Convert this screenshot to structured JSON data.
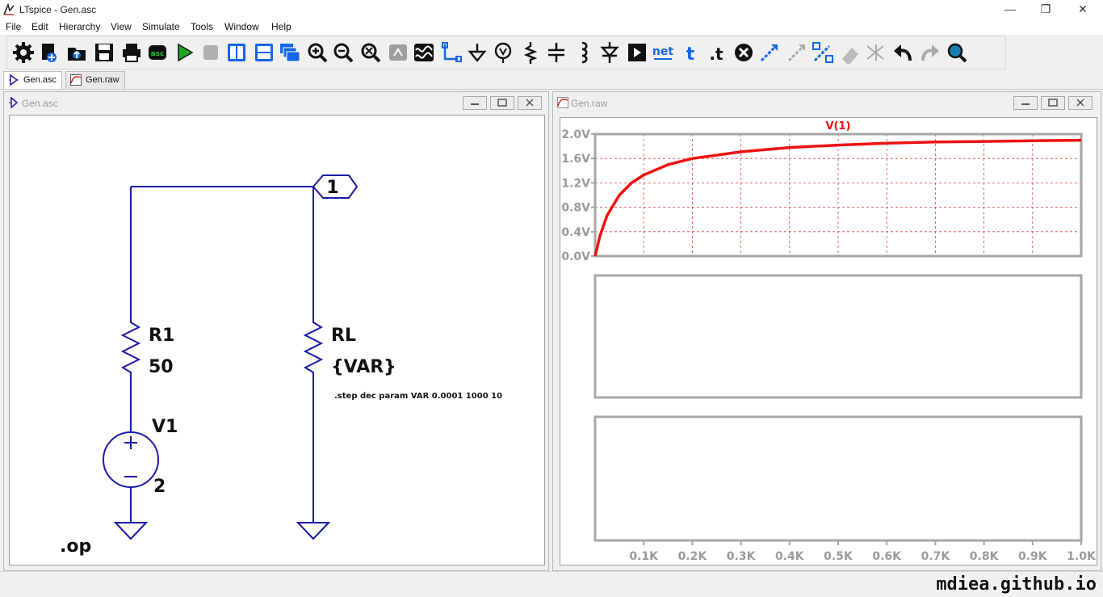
{
  "app": {
    "title": "LTspice - Gen.asc"
  },
  "window_controls": {
    "minimize": "—",
    "restore": "❐",
    "close": "✕"
  },
  "menu": [
    "File",
    "Edit",
    "Hierarchy",
    "View",
    "Simulate",
    "Tools",
    "Window",
    "Help"
  ],
  "toolbar": {
    "icons": [
      "gear-icon",
      "new-schematic-icon",
      "open-icon",
      "save-icon",
      "print-icon",
      "netlist-icon",
      "run-icon",
      "halt-icon",
      "tile-vertical-icon",
      "tile-horizontal-icon",
      "cascade-icon",
      "zoom-in-icon",
      "zoom-out-icon",
      "zoom-fit-icon",
      "autorange-icon",
      "fft-icon",
      "wire-icon",
      "ground-icon",
      "label-net-icon",
      "resistor-icon",
      "capacitor-icon",
      "inductor-icon",
      "diode-icon",
      "component-icon",
      "net-label-icon",
      "text-icon",
      "spice-directive-icon",
      "delete-icon",
      "move-icon",
      "drag-icon",
      "rotate-icon",
      "mirror-icon",
      "undo-icon",
      "redo-icon",
      "find-icon"
    ],
    "net_label": "net",
    "text_label": "t",
    "directive_label": ".t"
  },
  "tabs": [
    {
      "label": "Gen.asc",
      "active": true
    },
    {
      "label": "Gen.raw",
      "active": false
    }
  ],
  "schematic": {
    "window_title": "Gen.asc",
    "node_label": "1",
    "r1_name": "R1",
    "r1_value": "50",
    "rl_name": "RL",
    "rl_value": "{VAR}",
    "v1_name": "V1",
    "v1_value": "2",
    "step_directive": ".step dec param VAR 0.0001 1000 10",
    "op_directive": ".op",
    "wire_color": "#1a1aa6"
  },
  "waveform": {
    "window_title": "Gen.raw",
    "trace_color": "#ee1111",
    "grid_color": "#e04040"
  },
  "chart_data": {
    "type": "line",
    "title": "V(1)",
    "xlabel": "",
    "ylabel": "",
    "x_ticks": [
      "0.1K",
      "0.2K",
      "0.3K",
      "0.4K",
      "0.5K",
      "0.6K",
      "0.7K",
      "0.8K",
      "0.9K",
      "1.0K"
    ],
    "y_ticks": [
      "0.0V",
      "0.4V",
      "0.8V",
      "1.2V",
      "1.6V",
      "2.0V"
    ],
    "xlim": [
      0,
      1000
    ],
    "ylim": [
      0,
      2
    ],
    "grid": true,
    "series": [
      {
        "name": "V(1)",
        "x": [
          0,
          10,
          25,
          50,
          75,
          100,
          150,
          200,
          300,
          400,
          500,
          600,
          700,
          800,
          900,
          1000
        ],
        "values": [
          0,
          0.33,
          0.67,
          1.0,
          1.2,
          1.33,
          1.5,
          1.6,
          1.71,
          1.78,
          1.82,
          1.85,
          1.87,
          1.88,
          1.89,
          1.9
        ]
      }
    ]
  },
  "status": {
    "watermark": "mdiea.github.io"
  }
}
